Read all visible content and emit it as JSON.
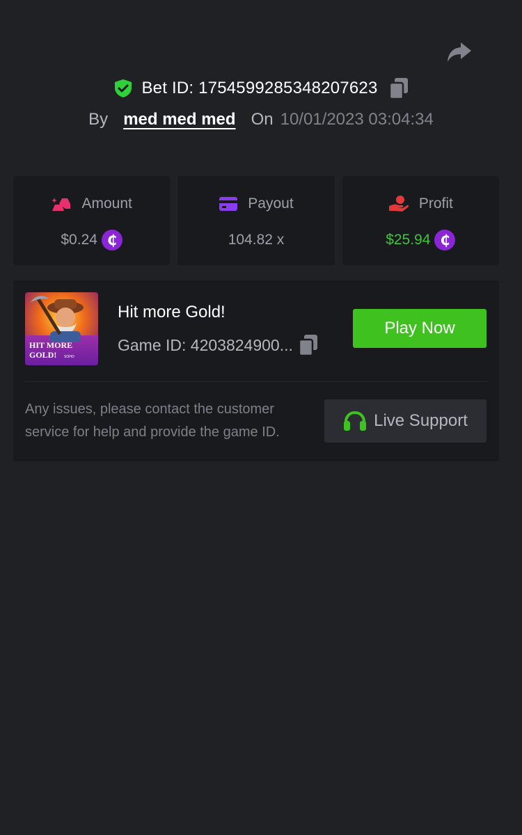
{
  "header": {
    "bet_id_label": "Bet ID: 1754599285348207623",
    "by_label": "By",
    "username": "med med med",
    "on_label": "On",
    "datetime": "10/01/2023 03:04:34"
  },
  "stats": [
    {
      "label": "Amount",
      "value": "$0.24",
      "icon": "gold-bars-icon",
      "has_coin": true
    },
    {
      "label": "Payout",
      "value": "104.82 x",
      "icon": "card-icon",
      "has_coin": false
    },
    {
      "label": "Profit",
      "value": "$25.94",
      "icon": "hand-coin-icon",
      "has_coin": true
    }
  ],
  "game": {
    "title": "Hit more Gold!",
    "game_id_label": "Game ID: 4203824900...",
    "thumb_text_line1": "HIT MORE",
    "thumb_text_line2": "GOLD!",
    "thumb_tag": "SOHO",
    "play_label": "Play Now"
  },
  "support": {
    "help_text": "Any issues, please contact the customer service for help and provide the game ID.",
    "live_label": "Live Support"
  },
  "colors": {
    "background": "#202125",
    "card": "#191a1d",
    "accent_green": "#3fc21f",
    "profit_green": "#3fc53a",
    "coin_purple": "#8a26d6",
    "icon_pink": "#e8306d",
    "icon_purple": "#8a3df0",
    "icon_red": "#e23a3a"
  }
}
